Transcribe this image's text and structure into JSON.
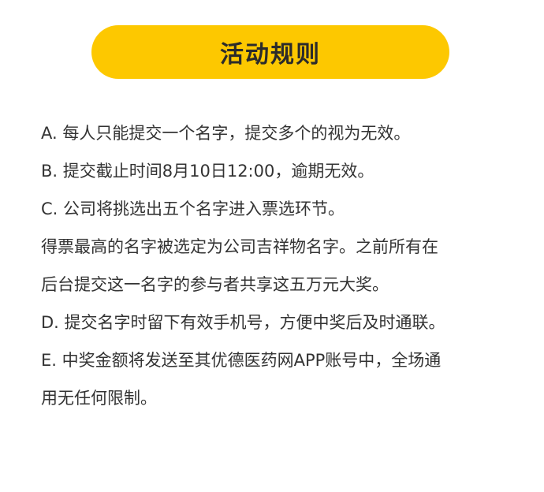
{
  "title": "活动规则",
  "rules": [
    "A. 每人只能提交一个名字，提交多个的视为无效。",
    "B. 提交截止时间8月10日12:00，逾期无效。",
    "C. 公司将挑选出五个名字进入票选环节。",
    "得票最高的名字被选定为公司吉祥物名字。之前所有在",
    "后台提交这一名字的参与者共享这五万元大奖。",
    "D. 提交名字时留下有效手机号，方便中奖后及时通联。",
    "E. 中奖金额将发送至其优德医药网APP账号中，全场通",
    "用无任何限制。"
  ],
  "colors": {
    "accent": "#fdc800",
    "title_text": "#2b2b2b",
    "body_text": "#333333",
    "background": "#ffffff"
  }
}
